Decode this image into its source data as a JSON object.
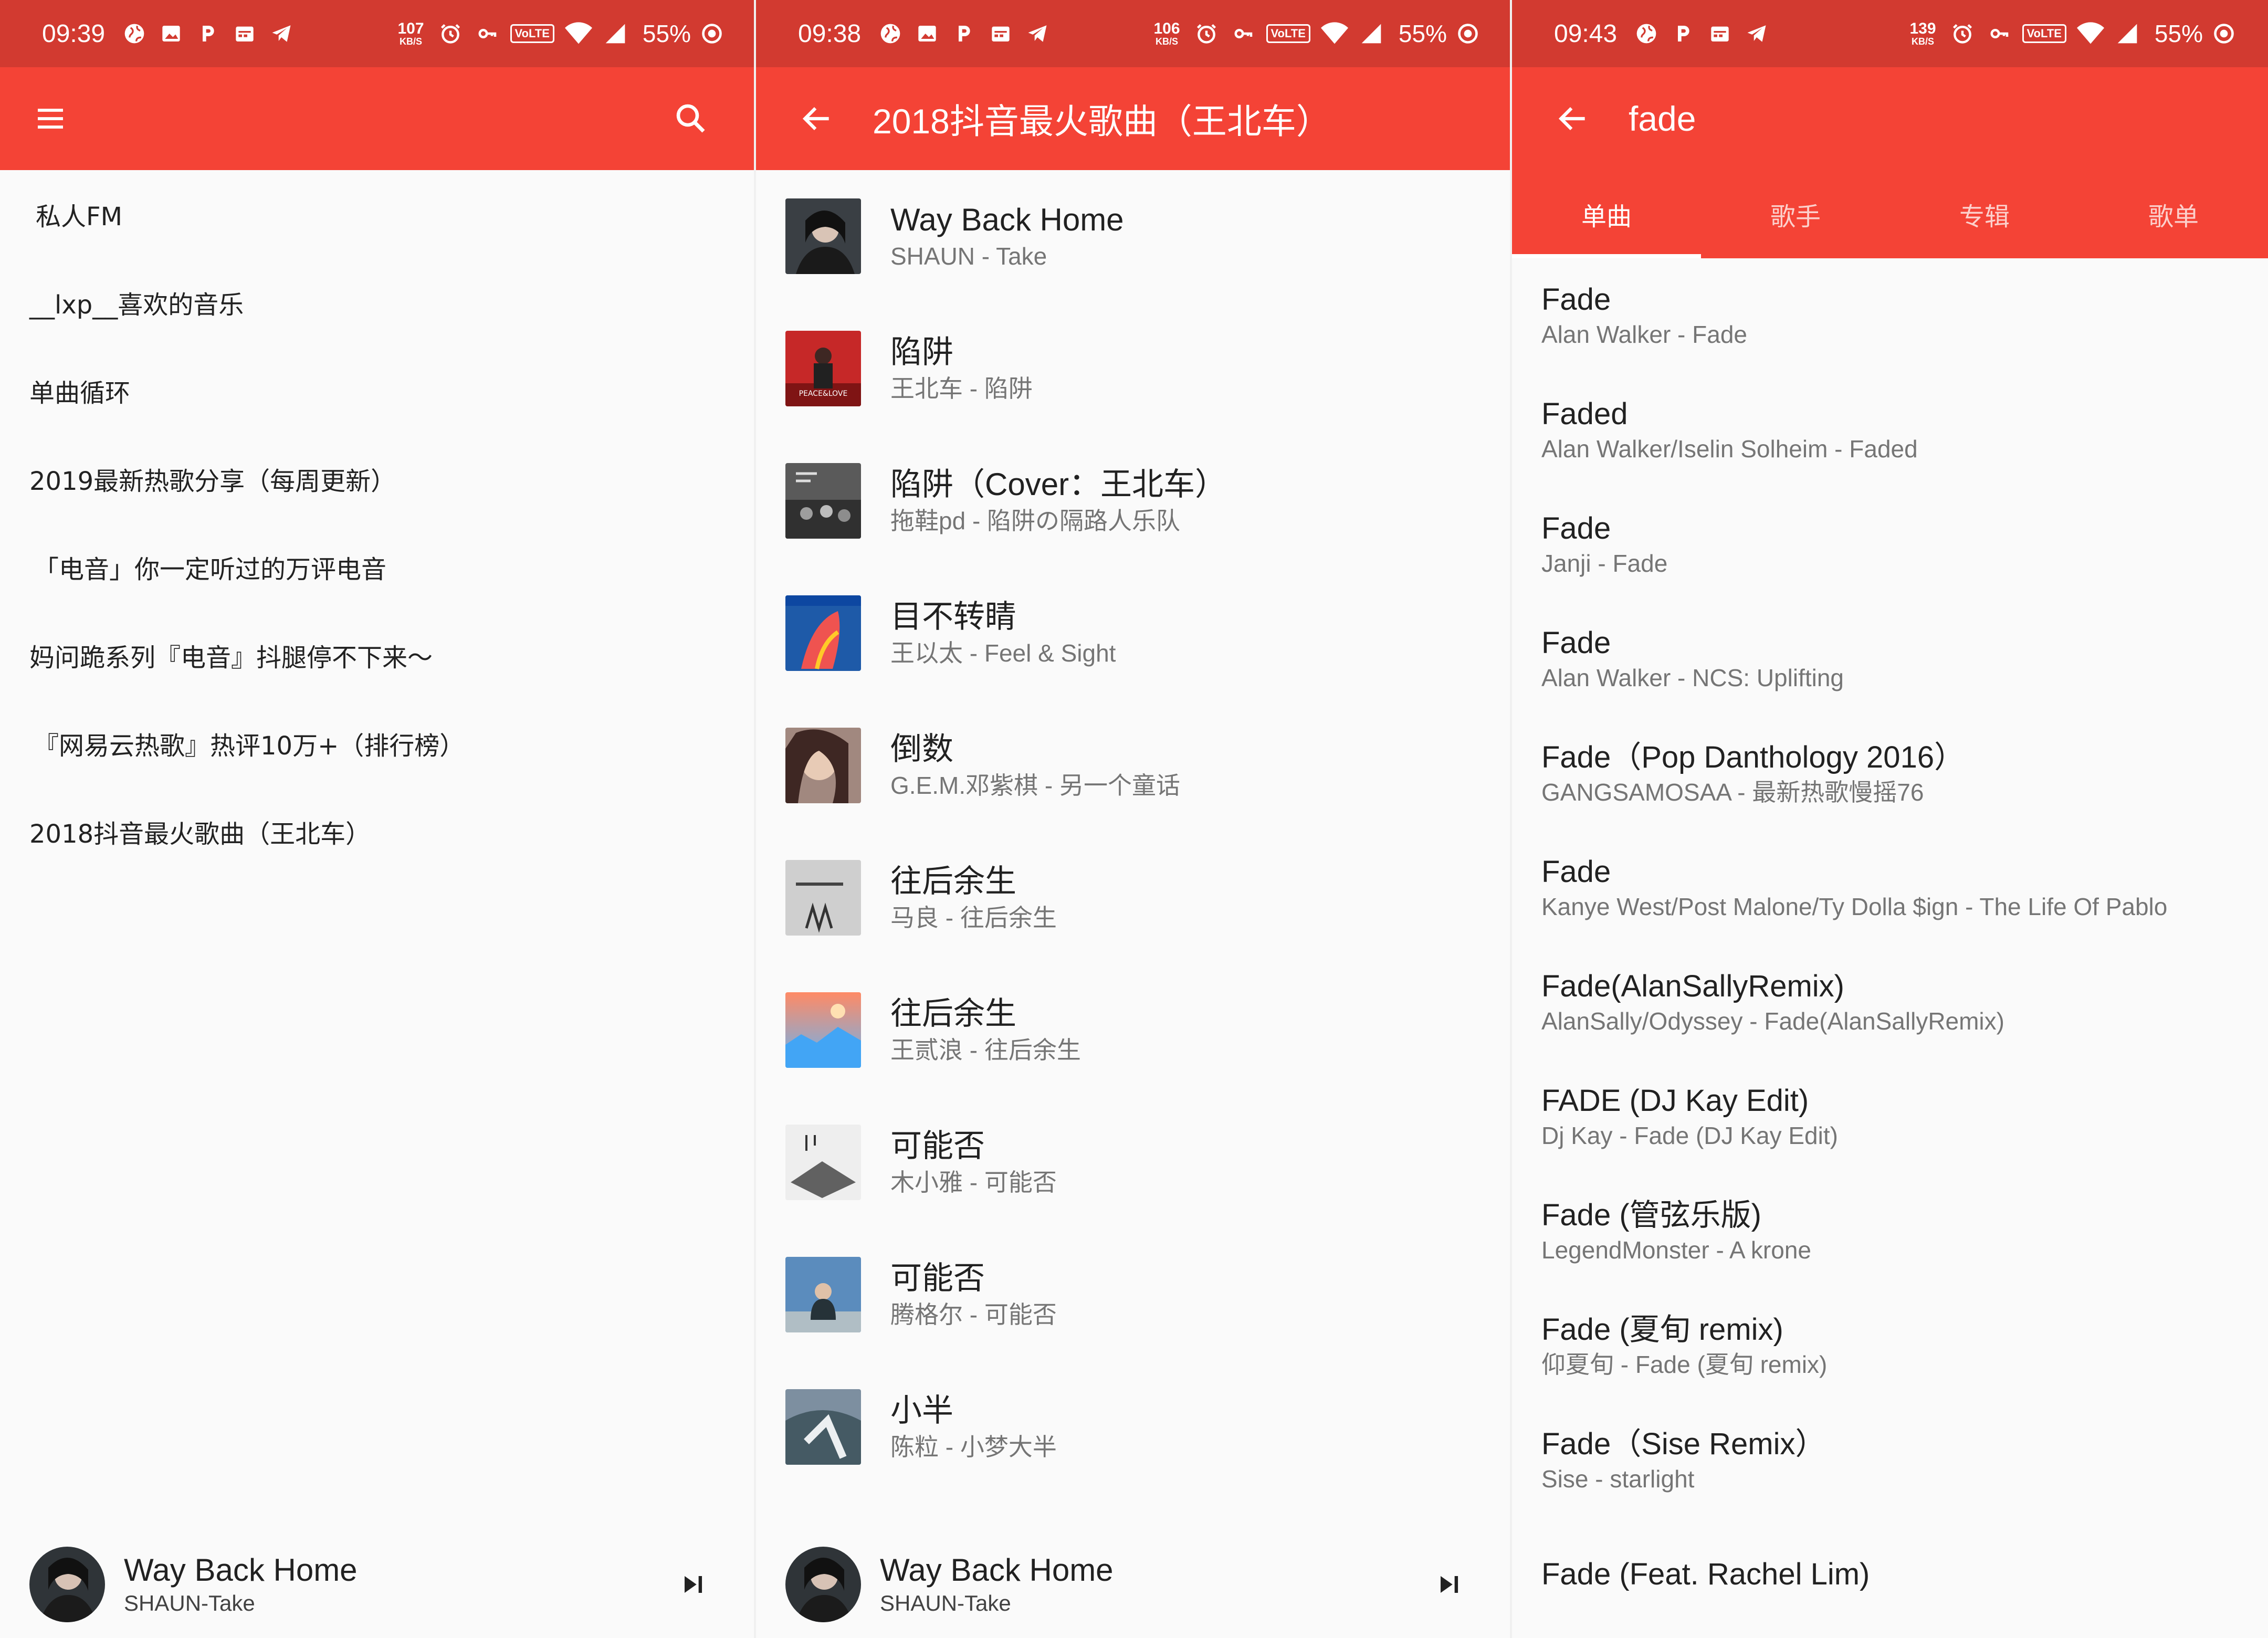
{
  "colors": {
    "status_bar": "#d23a30",
    "app_bar": "#f44336",
    "background": "#fafafa",
    "primary_text": "#212121",
    "secondary_text": "#757575"
  },
  "panels": [
    {
      "status": {
        "time": "09:39",
        "speed": "107",
        "speed_unit": "KB/S",
        "volte": "VoLTE",
        "battery": "55%"
      },
      "appbar": {
        "menu_icon": "menu-icon",
        "search_icon": "search-icon"
      },
      "playlists": [
        "私人FM",
        "__lxp__喜欢的音乐",
        "单曲循环",
        "2019最新热歌分享（每周更新）",
        "「电音」你一定听过的万评电音",
        "妈问跪系列『电音』抖腿停不下来～",
        "『网易云热歌』热评10万+（排行榜）",
        "2018抖音最火歌曲（王北车）"
      ],
      "player": {
        "title": "Way Back Home",
        "subtitle": "SHAUN-Take",
        "next_icon": "skip-next-icon"
      }
    },
    {
      "status": {
        "time": "09:38",
        "speed": "106",
        "speed_unit": "KB/S",
        "volte": "VoLTE",
        "battery": "55%"
      },
      "appbar": {
        "title": "2018抖音最火歌曲（王北车）",
        "back_icon": "arrow-back-icon"
      },
      "songs": [
        {
          "title": "Way Back Home",
          "subtitle": "SHAUN - Take",
          "cover": "#3a3f44"
        },
        {
          "title": "陷阱",
          "subtitle": "王北车 - 陷阱",
          "cover": "#b71c1c"
        },
        {
          "title": "陷阱（Cover：王北车）",
          "subtitle": "拖鞋pd - 陷阱の隔路人乐队",
          "cover": "#4e4e4e"
        },
        {
          "title": "目不转睛",
          "subtitle": "王以太 - Feel & Sight",
          "cover": "#1e5aa8"
        },
        {
          "title": "倒数",
          "subtitle": "G.E.M.邓紫棋 - 另一个童话",
          "cover": "#8d6e63"
        },
        {
          "title": "往后余生",
          "subtitle": "马良 - 往后余生",
          "cover": "#bdbdbd"
        },
        {
          "title": "往后余生",
          "subtitle": "王贰浪 - 往后余生",
          "cover": "#ff8a65"
        },
        {
          "title": "可能否",
          "subtitle": "木小雅 - 可能否",
          "cover": "#e0e0e0"
        },
        {
          "title": "可能否",
          "subtitle": "腾格尔 - 可能否",
          "cover": "#4a7aa8"
        },
        {
          "title": "小半",
          "subtitle": "陈粒 - 小梦大半",
          "cover": "#7d8fa0"
        }
      ],
      "player": {
        "title": "Way Back Home",
        "subtitle": "SHAUN-Take",
        "next_icon": "skip-next-icon"
      }
    },
    {
      "status": {
        "time": "09:43",
        "speed": "139",
        "speed_unit": "KB/S",
        "volte": "VoLTE",
        "battery": "55%"
      },
      "appbar": {
        "query": "fade",
        "back_icon": "arrow-back-icon"
      },
      "tabs": [
        "单曲",
        "歌手",
        "专辑",
        "歌单"
      ],
      "active_tab": 0,
      "results": [
        {
          "title": "Fade",
          "subtitle": "Alan Walker - Fade"
        },
        {
          "title": "Faded",
          "subtitle": "Alan Walker/Iselin Solheim - Faded"
        },
        {
          "title": "Fade",
          "subtitle": "Janji - Fade"
        },
        {
          "title": "Fade",
          "subtitle": "Alan Walker - NCS: Uplifting"
        },
        {
          "title": "Fade（Pop Danthology 2016）",
          "subtitle": "GANGSAMOSAA - 最新热歌慢摇76"
        },
        {
          "title": "Fade",
          "subtitle": "Kanye West/Post Malone/Ty Dolla $ign - The Life Of Pablo"
        },
        {
          "title": "Fade(AlanSallyRemix)",
          "subtitle": "AlanSally/Odyssey - Fade(AlanSallyRemix)"
        },
        {
          "title": "FADE (DJ Kay Edit)",
          "subtitle": "Dj Kay - Fade (DJ Kay Edit)"
        },
        {
          "title": "Fade (管弦乐版)",
          "subtitle": "LegendMonster - A krone"
        },
        {
          "title": "Fade (夏旬 remix)",
          "subtitle": "仰夏旬 - Fade (夏旬 remix)"
        },
        {
          "title": "Fade（Sise Remix）",
          "subtitle": "Sise - starlight"
        },
        {
          "title": "Fade (Feat. Rachel Lim)",
          "subtitle": ""
        }
      ]
    }
  ]
}
